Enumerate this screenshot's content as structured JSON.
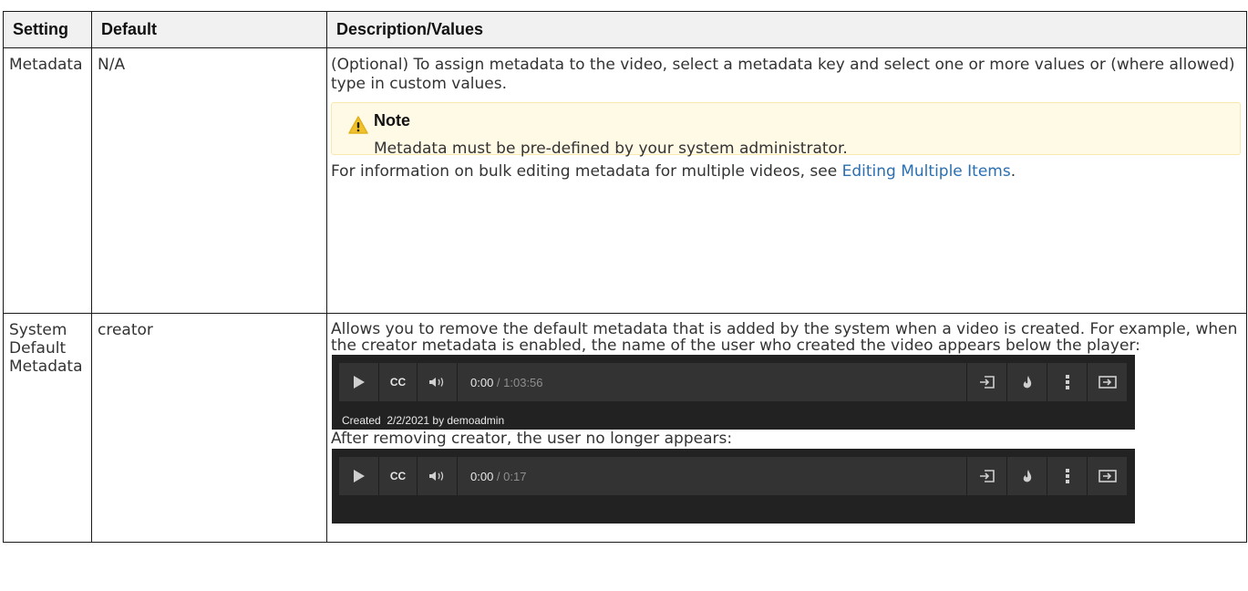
{
  "table": {
    "headers": [
      "Setting",
      "Default",
      "Description/Values"
    ],
    "rows": [
      {
        "setting": "Metadata",
        "default": "N/A",
        "description_intro": "(Optional) To assign metadata to the video, select a metadata key and select one or more values or (where allowed) type in custom values.",
        "note": {
          "title": "Note",
          "body": "Metadata must be pre-defined by your system administrator.",
          "icon": "warning-icon",
          "background": "#fffae6",
          "icon_color": "#f0c12c"
        },
        "description_outro_prefix": "For information on bulk editing metadata for multiple videos, see ",
        "link_text": "Editing Multiple Items",
        "description_outro_suffix": "."
      },
      {
        "setting": "System Default Metadata",
        "default": "creator",
        "description_intro": "Allows you to remove the default metadata that is added by the system when a video is created. For example, when the creator metadata is enabled, the name of the user who created the video appears below the player:",
        "player1": {
          "cc_label": "CC",
          "time_current": "0:00",
          "time_duration": " / 1:03:56",
          "created_label": "Created",
          "created_value": "2/2/2021 by demoadmin"
        },
        "after_text": "After removing creator, the user no longer appears:",
        "player2": {
          "cc_label": "CC",
          "time_current": "0:00",
          "time_duration": " / 0:17"
        }
      }
    ]
  },
  "colors": {
    "link": "#2a6fb1",
    "player_bg": "#222222",
    "player_bar": "#333333"
  }
}
